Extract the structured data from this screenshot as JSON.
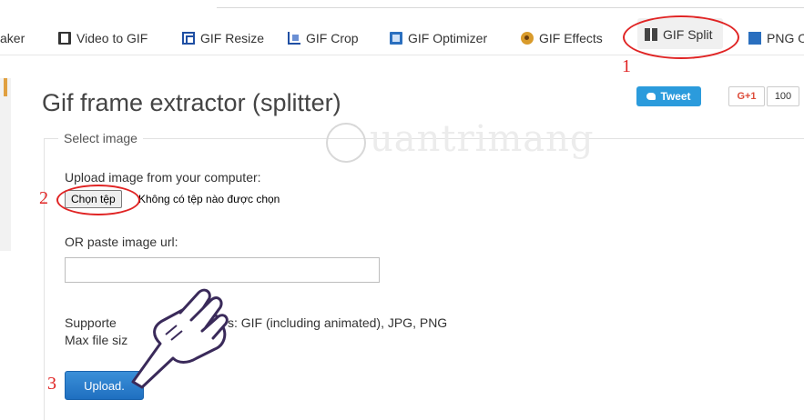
{
  "nav": {
    "items": [
      {
        "label": "aker",
        "icon": "none"
      },
      {
        "label": "Video to GIF",
        "icon": "film-icon"
      },
      {
        "label": "GIF Resize",
        "icon": "resize-icon"
      },
      {
        "label": "GIF Crop",
        "icon": "crop-icon"
      },
      {
        "label": "GIF Optimizer",
        "icon": "optimizer-icon"
      },
      {
        "label": "GIF Effects",
        "icon": "effects-icon"
      },
      {
        "label": "GIF Split",
        "icon": "split-icon",
        "active": true
      },
      {
        "label": "PNG O",
        "icon": "png-icon"
      }
    ]
  },
  "page": {
    "title": "Gif frame extractor (splitter)"
  },
  "social": {
    "tweet_label": "Tweet",
    "gplus_label": "G+1",
    "gplus_count": "100"
  },
  "form": {
    "legend": "Select image",
    "upload_label": "Upload image from your computer:",
    "choose_file_label": "Chọn tệp",
    "no_file_text": "Không có tệp nào được chọn",
    "url_label": "OR paste image url:",
    "url_value": "",
    "supported_text": "Supporte",
    "supported_text_tail": "s: GIF (including animated), JPG, PNG",
    "max_size_text": "Max file siz",
    "upload_button": "Upload."
  },
  "annotations": {
    "step1": "1",
    "step2": "2",
    "step3": "3",
    "color": "#e02424"
  },
  "watermark": {
    "text": "uantrimang"
  },
  "colors": {
    "tweet_bg": "#2b9bdc",
    "upload_bg": "#1f6fc0"
  }
}
